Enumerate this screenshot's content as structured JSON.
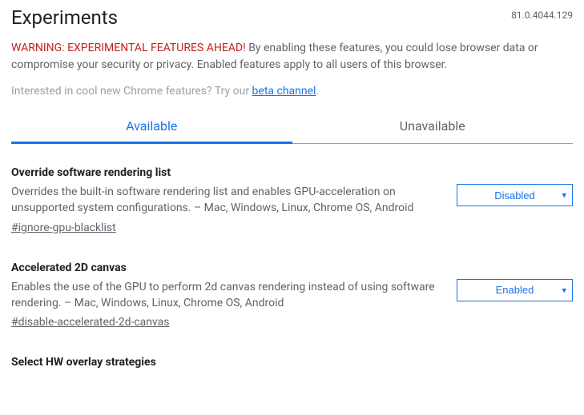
{
  "header": {
    "title": "Experiments",
    "version": "81.0.4044.129"
  },
  "warning": {
    "label": "WARNING: EXPERIMENTAL FEATURES AHEAD!",
    "text": " By enabling these features, you could lose browser data or compromise your security or privacy. Enabled features apply to all users of this browser."
  },
  "interested": {
    "prefix": "Interested in cool new Chrome features? Try our ",
    "link_text": "beta channel",
    "suffix": "."
  },
  "tabs": {
    "available": "Available",
    "unavailable": "Unavailable"
  },
  "flags": [
    {
      "title": "Override software rendering list",
      "desc": "Overrides the built-in software rendering list and enables GPU-acceleration on unsupported system configurations. – Mac, Windows, Linux, Chrome OS, Android",
      "hash": "#ignore-gpu-blacklist",
      "value": "Disabled"
    },
    {
      "title": "Accelerated 2D canvas",
      "desc": "Enables the use of the GPU to perform 2d canvas rendering instead of using software rendering. – Mac, Windows, Linux, Chrome OS, Android",
      "hash": "#disable-accelerated-2d-canvas",
      "value": "Enabled"
    },
    {
      "title": "Select HW overlay strategies",
      "desc": "",
      "hash": "",
      "value": ""
    }
  ]
}
